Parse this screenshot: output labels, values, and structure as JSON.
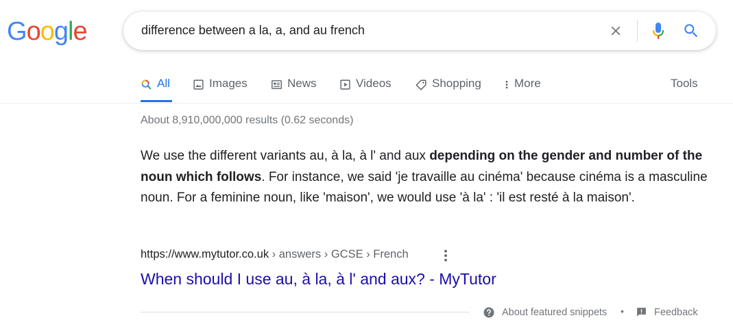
{
  "logo": {
    "letters": [
      "G",
      "o",
      "o",
      "g",
      "l",
      "e"
    ],
    "colors": [
      "#4285f4",
      "#ea4335",
      "#fbbc05",
      "#4285f4",
      "#34a853",
      "#ea4335"
    ]
  },
  "search": {
    "query": "difference between a la, a, and au french"
  },
  "tabs": [
    {
      "label": "All",
      "icon": "search-multicolor-icon",
      "active": true
    },
    {
      "label": "Images",
      "icon": "image-icon"
    },
    {
      "label": "News",
      "icon": "newspaper-icon"
    },
    {
      "label": "Videos",
      "icon": "play-icon"
    },
    {
      "label": "Shopping",
      "icon": "tag-icon"
    },
    {
      "label": "More",
      "icon": "more-vert-icon"
    }
  ],
  "tools_label": "Tools",
  "stats": "About 8,910,000,000 results (0.62 seconds)",
  "snippet": {
    "before": "We use the different variants au, à la, à l' and aux ",
    "bold": "depending on the gender and number of the noun which follows",
    "after": ". For instance, we said 'je travaille au cinéma' because cinéma is a masculine noun. For a feminine noun, like 'maison', we would use 'à la' : 'il est resté à la maison'."
  },
  "result": {
    "url": "https://www.mytutor.co.uk",
    "breadcrumbs": " › answers › GCSE › French",
    "title": "When should I use au, à la, à l' and aux? - MyTutor"
  },
  "footer": {
    "about_label": "About featured snippets",
    "separator": "•",
    "feedback_label": "Feedback"
  },
  "colors": {
    "accent": "#1a73e8",
    "link": "#1a0dab",
    "muted": "#70757a"
  }
}
